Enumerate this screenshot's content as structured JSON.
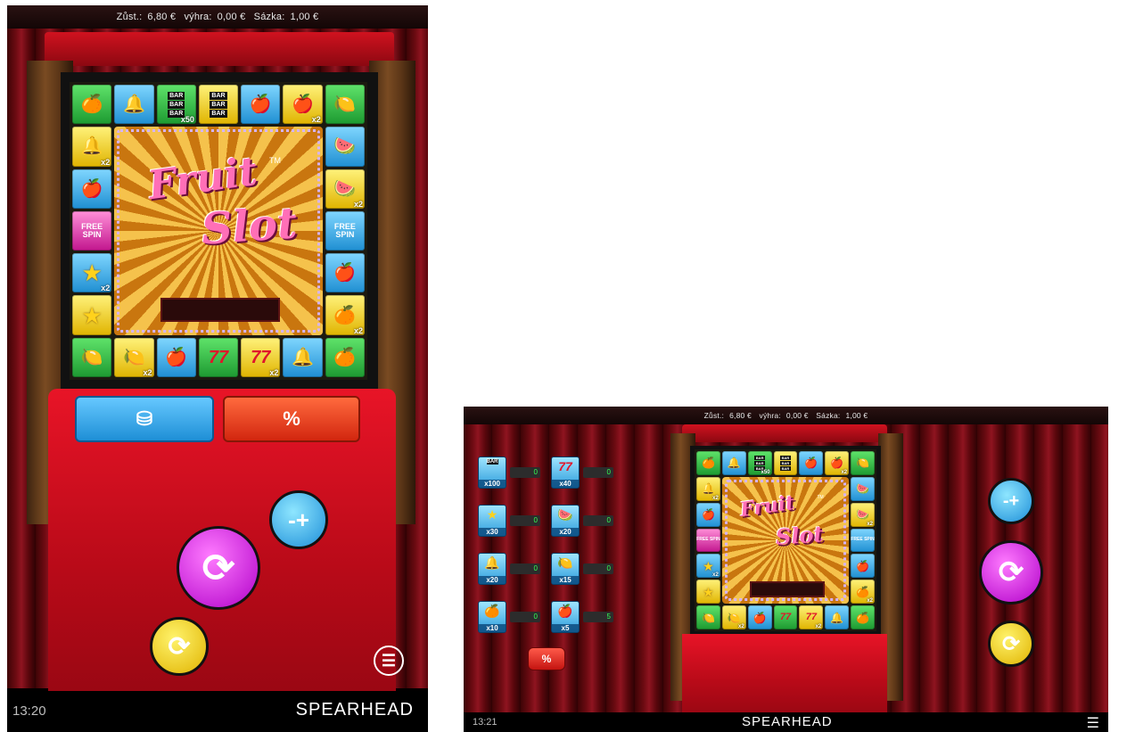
{
  "status": {
    "balance_label": "Zůst.:",
    "balance_value": "6,80 €",
    "win_label": "výhra:",
    "win_value": "0,00 €",
    "bet_label": "Sázka:",
    "bet_value": "1,00 €"
  },
  "portrait": {
    "clock": "13:20",
    "brand": "SPEARHEAD"
  },
  "landscape": {
    "clock": "13:21",
    "brand": "SPEARHEAD"
  },
  "logo": {
    "line1": "Fruit",
    "line2": "Slot",
    "tm": "TM"
  },
  "board": {
    "top": [
      {
        "sym": "🍊",
        "color": "green",
        "mult": ""
      },
      {
        "sym": "🔔",
        "color": "blue",
        "mult": ""
      },
      {
        "sym": "BAR",
        "color": "green",
        "mult": "x50",
        "bar": true
      },
      {
        "sym": "BAR",
        "color": "yellow",
        "mult": "",
        "bar": true
      },
      {
        "sym": "🍎",
        "color": "blue",
        "mult": ""
      },
      {
        "sym": "🍎",
        "color": "yellow",
        "mult": "x2"
      },
      {
        "sym": "🍋",
        "color": "green",
        "mult": ""
      }
    ],
    "bottom": [
      {
        "sym": "🍋",
        "color": "green",
        "mult": ""
      },
      {
        "sym": "🍋",
        "color": "yellow",
        "mult": "x2"
      },
      {
        "sym": "🍎",
        "color": "blue",
        "mult": ""
      },
      {
        "sym": "77",
        "color": "green",
        "mult": ""
      },
      {
        "sym": "77",
        "color": "yellow",
        "mult": "x2"
      },
      {
        "sym": "🔔",
        "color": "blue",
        "mult": ""
      },
      {
        "sym": "🍊",
        "color": "green",
        "mult": ""
      }
    ],
    "left": [
      {
        "sym": "🔔",
        "color": "yellow",
        "mult": "x2"
      },
      {
        "sym": "🍎",
        "color": "blue",
        "mult": ""
      },
      {
        "sym": "FREE SPIN",
        "color": "pink",
        "mult": ""
      },
      {
        "sym": "★",
        "color": "blue",
        "mult": "x2"
      },
      {
        "sym": "★",
        "color": "yellow",
        "mult": ""
      }
    ],
    "right": [
      {
        "sym": "🍉",
        "color": "blue",
        "mult": ""
      },
      {
        "sym": "🍉",
        "color": "yellow",
        "mult": "x2"
      },
      {
        "sym": "FREE SPIN",
        "color": "blue",
        "mult": ""
      },
      {
        "sym": "🍎",
        "color": "blue",
        "mult": ""
      },
      {
        "sym": "🍊",
        "color": "yellow",
        "mult": "x2"
      }
    ]
  },
  "paytable": [
    {
      "sym": "BAR",
      "label": "x100",
      "count": "0",
      "bar": true
    },
    {
      "sym": "77",
      "label": "x40",
      "count": "0"
    },
    {
      "sym": "★",
      "label": "x30",
      "count": "0"
    },
    {
      "sym": "🍉",
      "label": "x20",
      "count": "0"
    },
    {
      "sym": "🔔",
      "label": "x20",
      "count": "0"
    },
    {
      "sym": "🍋",
      "label": "x15",
      "count": "0"
    },
    {
      "sym": "🍊",
      "label": "x10",
      "count": "0"
    },
    {
      "sym": "🍎",
      "label": "x5",
      "count": "5"
    }
  ],
  "controls": {
    "bet_icon": "minus-plus",
    "spin_icon": "circular-arrow",
    "auto_icon": "circular-arrow-small",
    "menu_icon": "hamburger",
    "add_coins_icon": "coin-stack",
    "collect_icon": "coin-stack-percent"
  },
  "colors": {
    "spin": "#b000c8",
    "bet": "#1d8ed8",
    "auto": "#e0b300",
    "collect": "#e8321a",
    "add_coins": "#1ea0e6",
    "cabinet": "#d0121f"
  }
}
